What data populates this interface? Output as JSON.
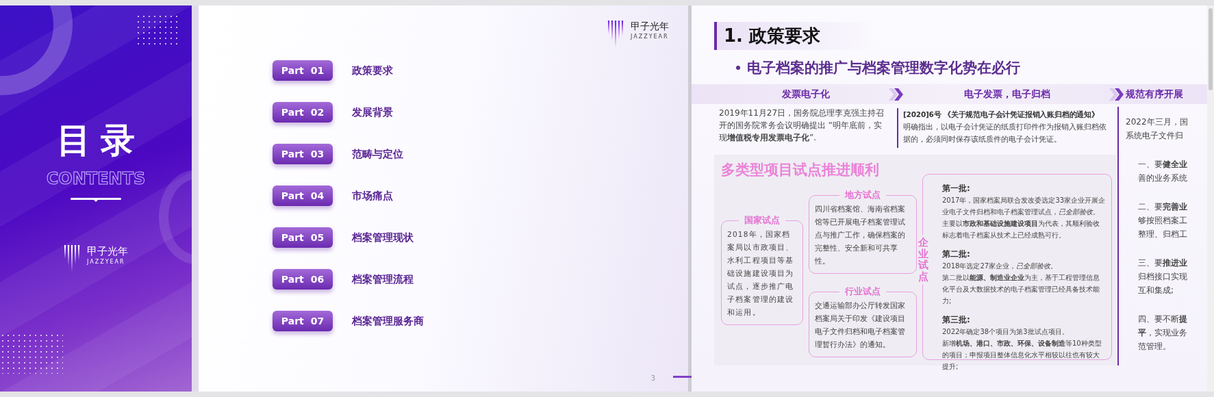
{
  "contents_panel": {
    "title": "目录",
    "subtitle": "CONTENTS",
    "logo": {
      "name": "甲子光年",
      "tagline": "JAZZYEAR"
    }
  },
  "toc_slide": {
    "logo": {
      "name": "甲子光年",
      "tagline": "JAZZYEAR"
    },
    "items": [
      {
        "part": "Part 01",
        "title": "政策要求"
      },
      {
        "part": "Part 02",
        "title": "发展背景"
      },
      {
        "part": "Part 03",
        "title": "范畴与定位"
      },
      {
        "part": "Part 04",
        "title": "市场痛点"
      },
      {
        "part": "Part 05",
        "title": "档案管理现状"
      },
      {
        "part": "Part 06",
        "title": "档案管理流程"
      },
      {
        "part": "Part 07",
        "title": "档案管理服务商"
      }
    ],
    "page_number": "3"
  },
  "policy_slide": {
    "heading": "1. 政策要求",
    "subheading": "电子档案的推广与档案管理数字化势在必行",
    "timeline": [
      {
        "label": "发票电子化",
        "text": "2019年11月27日，国务院总理李克强主持召开的国务院常务会议明确提出 “明年底前，实现**增值税专用发票电子化**”."
      },
      {
        "label": "电子发票，电子归档",
        "lead": "[2020]6号 《关于规范电子会计凭证报销入账归档的通知》",
        "text": "明确指出，以电子会计凭证的纸质打印件作为报销入账归档依据的，必须同时保存该纸质件的电子会计凭证。"
      },
      {
        "label": "规范有序开展",
        "blocks": [
          [
            "2022年三月，国",
            "系统电子文件归"
          ],
          [
            "一、要**健全业**",
            "善的业务系统"
          ],
          [
            "二、要**完善业**",
            "够按照档案工",
            "整理、归档工"
          ],
          [
            "三、要**推进业**",
            "归档接口实现",
            "互和集成;"
          ],
          [
            "四、要不断**提**",
            "**平**，实现业务",
            "范管理。"
          ]
        ]
      }
    ],
    "pilots": {
      "title": "多类型项目试点推进顺利",
      "cards": [
        {
          "kind": "national",
          "title": "国家试点",
          "text": "2018年，国家档案局以市政项目、水利工程项目等基础设施建设项目为试点，逐步推广电子档案管理的建设和运用。"
        },
        {
          "kind": "regional",
          "title": "地方试点",
          "text": "四川省档案馆、海南省档案馆等已开展电子档案管理试点与推广工作，确保档案的完整性、安全新和可共享性。"
        },
        {
          "kind": "industry",
          "title": "行业试点",
          "text": "交通运输部办公厅转发国家档案局关于印发《建设项目电子文件归档和电子档案管理暂行办法》的通知。"
        }
      ],
      "enterprise": {
        "label": "企业试点",
        "batches": [
          {
            "title": "第一批:",
            "paragraphs": [
              "2017年，国家档案局联合发改委选定33家企业开展企业电子文件归档和电子档案管理试点，*已全部验收。*",
              "主要以**市政和基础设施建设项目**为代表，其顺利验收标志着电子档案从技术上已经成熟可行。"
            ]
          },
          {
            "title": "第二批:",
            "paragraphs": [
              "2018年选定27家企业，*已全部验收。*",
              "第二批以**能源、制造业企业**为主，基于工程管理信息化平台及大数据技术的电子档案管理已经具备技术能力;"
            ]
          },
          {
            "title": "第三批:",
            "paragraphs": [
              "2022年确定38个项目为第3批试点项目。",
              "新增**机场、港口、市政、环保、设备制造**等10种类型的项目；申报项目整体信息化水平相较以往也有较大提升;"
            ]
          }
        ]
      }
    }
  }
}
